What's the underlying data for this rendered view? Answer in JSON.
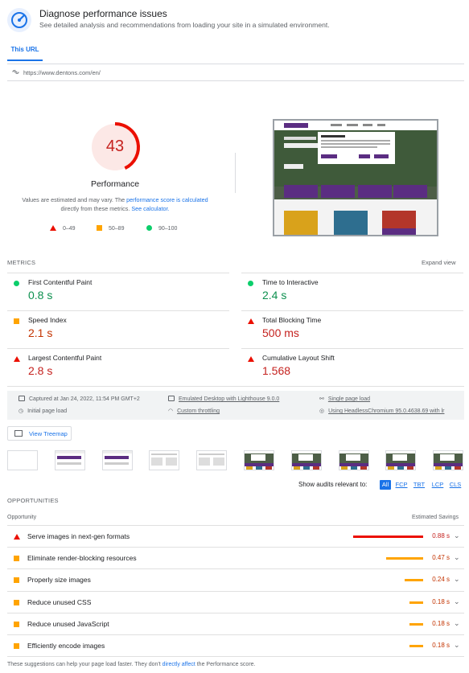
{
  "header": {
    "title": "Diagnose performance issues",
    "subtitle": "See detailed analysis and recommendations from loading your site in a simulated environment."
  },
  "tab": {
    "label": "This URL"
  },
  "url": {
    "value": "https://www.dentons.com/en/"
  },
  "performance": {
    "score": "43",
    "score_fraction": 0.43,
    "title": "Performance",
    "note_prefix": "Values are estimated and may vary. The ",
    "note_link1": "performance score is calculated",
    "note_middle": " directly from these metrics. ",
    "note_link2": "See calculator.",
    "legend": [
      {
        "range": "0–49"
      },
      {
        "range": "50–89"
      },
      {
        "range": "90–100"
      }
    ],
    "colors": {
      "fail": "#eb0f00",
      "average": "#ffa400",
      "pass": "#0cce6b"
    }
  },
  "metrics": {
    "section_label": "METRICS",
    "expand_label": "Expand view",
    "items": [
      {
        "label": "First Contentful Paint",
        "value": "0.8 s",
        "status": "pass"
      },
      {
        "label": "Time to Interactive",
        "value": "2.4 s",
        "status": "pass"
      },
      {
        "label": "Speed Index",
        "value": "2.1 s",
        "status": "average"
      },
      {
        "label": "Total Blocking Time",
        "value": "500 ms",
        "status": "fail"
      },
      {
        "label": "Largest Contentful Paint",
        "value": "2.8 s",
        "status": "fail"
      },
      {
        "label": "Cumulative Layout Shift",
        "value": "1.568",
        "status": "fail"
      }
    ]
  },
  "runinfo": {
    "captured": "Captured at Jan 24, 2022, 11:54 PM GMT+2",
    "device": "Emulated Desktop with Lighthouse 9.0.0",
    "load": "Single page load",
    "initial": "Initial page load",
    "throttling": "Custom throttling",
    "browser": "Using HeadlessChromium 95.0.4638.69 with lr"
  },
  "treemap": {
    "label": "View Treemap"
  },
  "filters": {
    "label": "Show audits relevant to:",
    "chips": [
      "All",
      "FCP",
      "TBT",
      "LCP",
      "CLS"
    ]
  },
  "opportunities": {
    "section_label": "OPPORTUNITIES",
    "col_opportunity": "Opportunity",
    "col_savings": "Estimated Savings",
    "items": [
      {
        "label": "Serve images in next-gen formats",
        "value": "0.88 s",
        "status": "fail",
        "fraction": 1.0
      },
      {
        "label": "Eliminate render-blocking resources",
        "value": "0.47 s",
        "status": "average",
        "fraction": 0.53
      },
      {
        "label": "Properly size images",
        "value": "0.24 s",
        "status": "average",
        "fraction": 0.27
      },
      {
        "label": "Reduce unused CSS",
        "value": "0.18 s",
        "status": "average",
        "fraction": 0.2
      },
      {
        "label": "Reduce unused JavaScript",
        "value": "0.18 s",
        "status": "average",
        "fraction": 0.2
      },
      {
        "label": "Efficiently encode images",
        "value": "0.18 s",
        "status": "average",
        "fraction": 0.2
      }
    ]
  },
  "footer": {
    "prefix": "These suggestions can help your page load faster. They don't ",
    "link": "directly affect",
    "suffix": " the Performance score."
  }
}
